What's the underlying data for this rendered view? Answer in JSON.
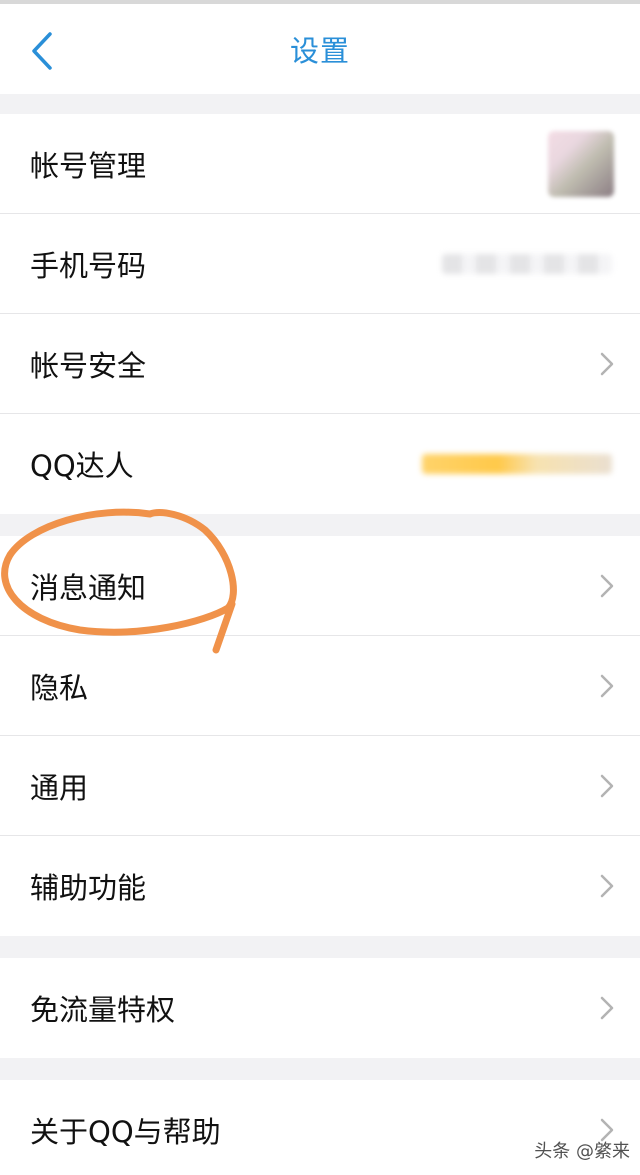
{
  "header": {
    "title": "设置",
    "back_icon": "chevron-left-icon"
  },
  "colors": {
    "accent": "#2a8fd8",
    "annotation": "#f0924a",
    "background": "#f2f2f4",
    "chevron": "#b3b3b3"
  },
  "groups": [
    {
      "items": [
        {
          "label": "帐号管理",
          "accessory": "avatar"
        },
        {
          "label": "手机号码",
          "accessory": "blurred-value"
        },
        {
          "label": "帐号安全",
          "accessory": "chevron"
        },
        {
          "label": "QQ达人",
          "accessory": "blurred-badge"
        }
      ]
    },
    {
      "items": [
        {
          "label": "消息通知",
          "accessory": "chevron",
          "annotated": true
        },
        {
          "label": "隐私",
          "accessory": "chevron"
        },
        {
          "label": "通用",
          "accessory": "chevron"
        },
        {
          "label": "辅助功能",
          "accessory": "chevron"
        }
      ]
    },
    {
      "items": [
        {
          "label": "免流量特权",
          "accessory": "chevron"
        }
      ]
    },
    {
      "items": [
        {
          "label": "关于QQ与帮助",
          "accessory": "chevron"
        }
      ]
    }
  ],
  "watermark": "头条 @綮来"
}
